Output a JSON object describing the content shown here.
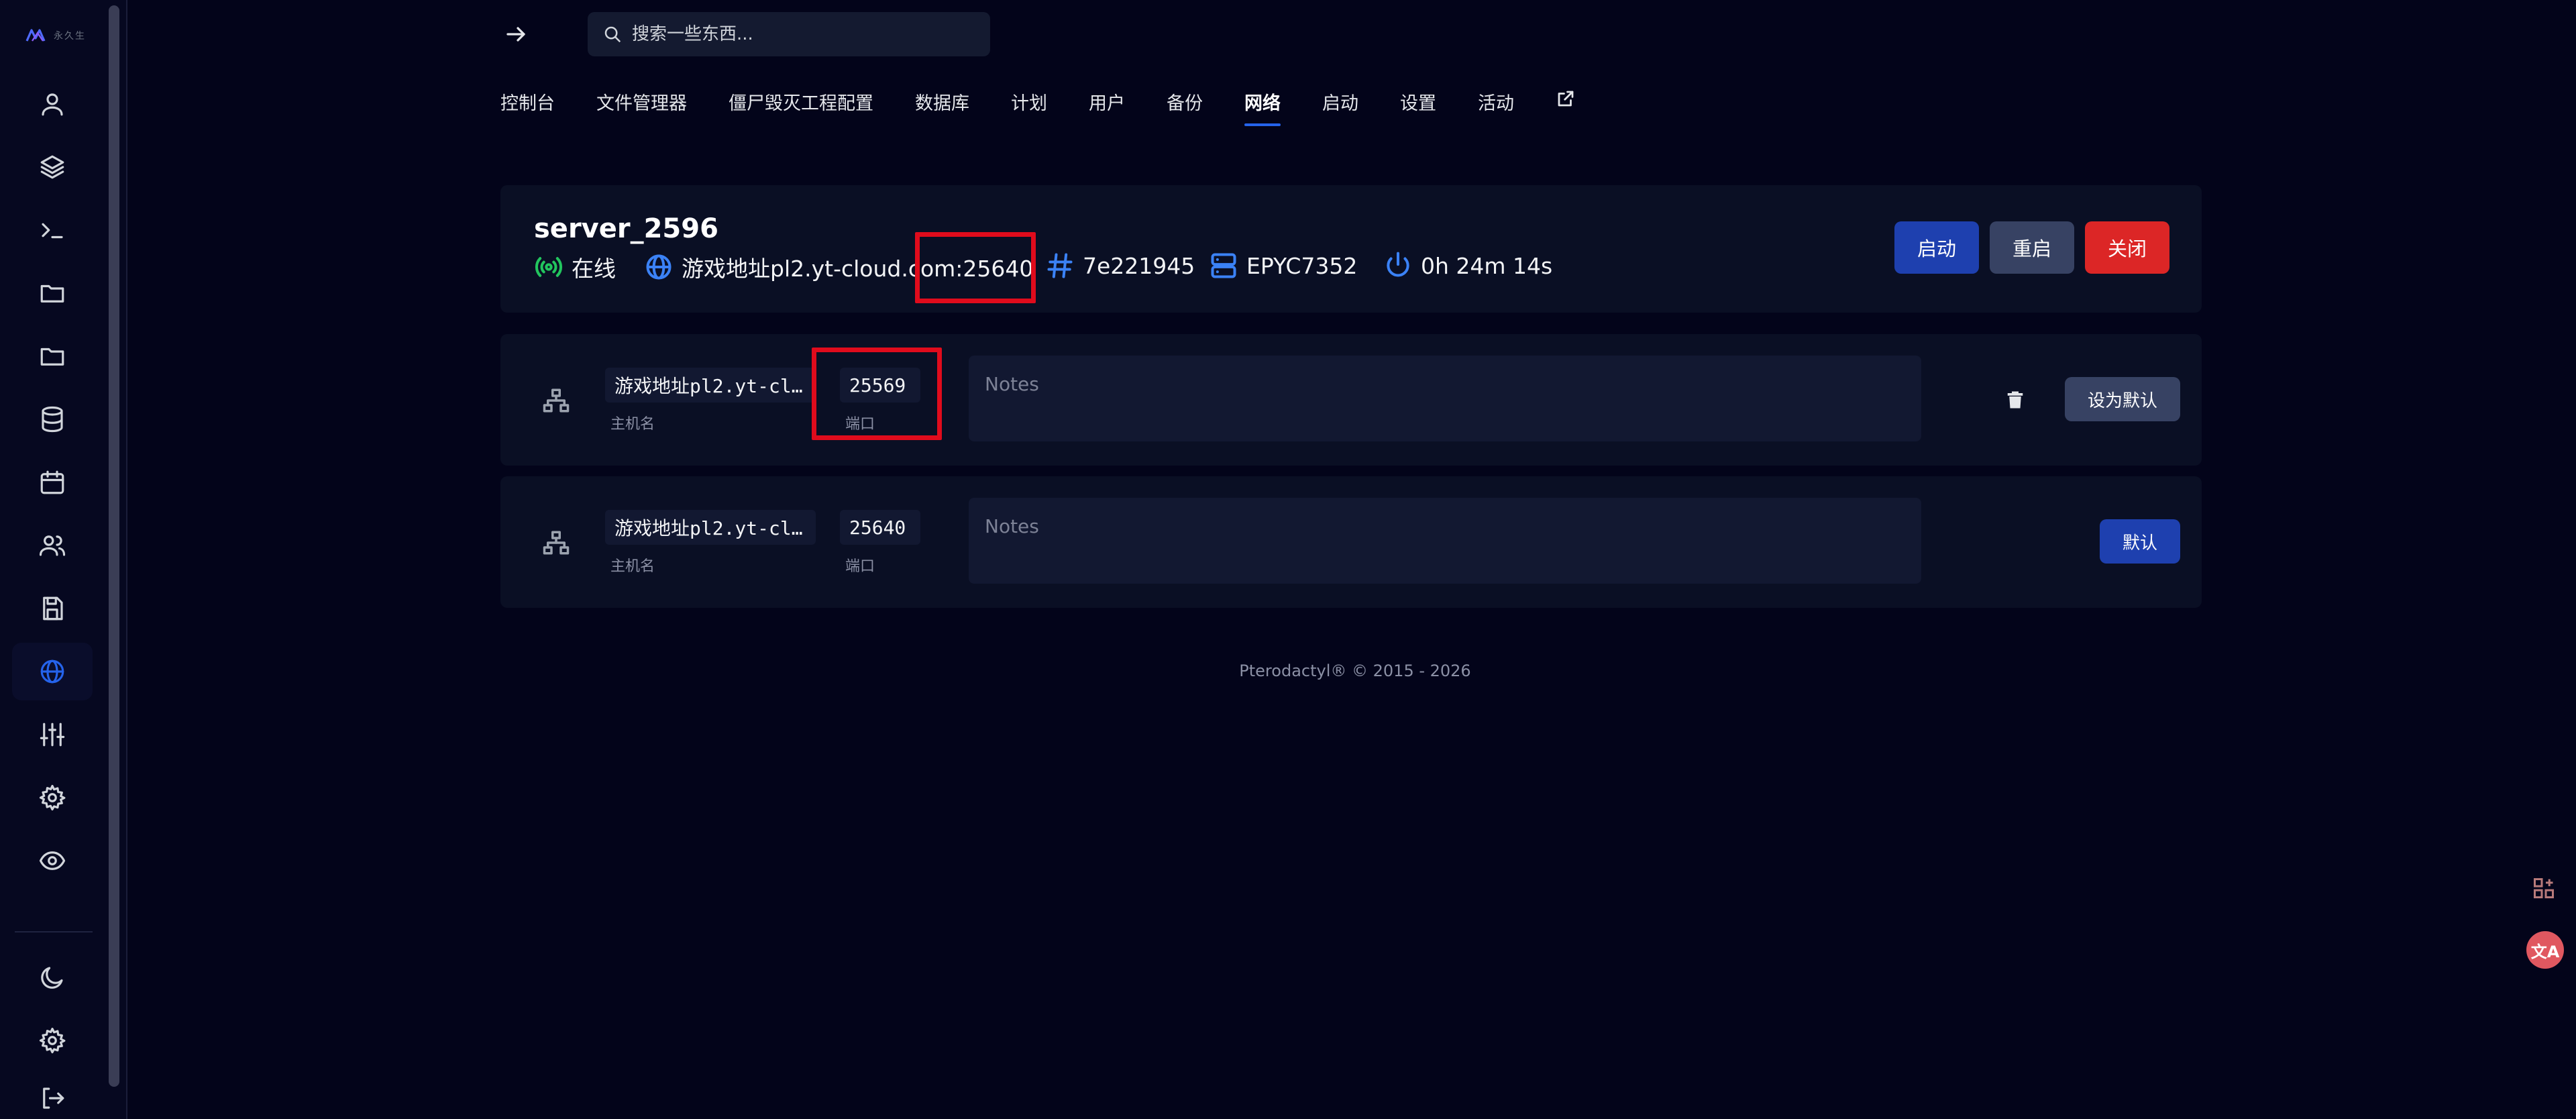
{
  "sidebar": {
    "logo_text": "永久生",
    "items": [
      {
        "name": "account",
        "icon": "user-icon"
      },
      {
        "name": "servers",
        "icon": "layers-icon"
      },
      {
        "name": "console",
        "icon": "terminal-icon"
      },
      {
        "name": "files",
        "icon": "folder-icon"
      },
      {
        "name": "folder",
        "icon": "folder-icon"
      },
      {
        "name": "database",
        "icon": "database-icon"
      },
      {
        "name": "schedules",
        "icon": "calendar-icon"
      },
      {
        "name": "users",
        "icon": "users-icon"
      },
      {
        "name": "backups",
        "icon": "save-icon"
      },
      {
        "name": "network",
        "icon": "globe-icon",
        "active": true
      },
      {
        "name": "startup",
        "icon": "sliders-icon"
      },
      {
        "name": "settings",
        "icon": "gear-icon"
      },
      {
        "name": "activity",
        "icon": "eye-icon"
      }
    ],
    "bottom": [
      {
        "name": "theme",
        "icon": "moon-icon"
      },
      {
        "name": "admin",
        "icon": "gear-icon"
      },
      {
        "name": "logout",
        "icon": "logout-icon"
      }
    ]
  },
  "search": {
    "placeholder": "搜索一些东西..."
  },
  "tabs": [
    {
      "label": "控制台"
    },
    {
      "label": "文件管理器"
    },
    {
      "label": "僵尸毁灭工程配置"
    },
    {
      "label": "数据库"
    },
    {
      "label": "计划"
    },
    {
      "label": "用户"
    },
    {
      "label": "备份"
    },
    {
      "label": "网络",
      "active": true
    },
    {
      "label": "启动"
    },
    {
      "label": "设置"
    },
    {
      "label": "活动"
    }
  ],
  "server": {
    "name": "server_2596",
    "status": "在线",
    "address": "游戏地址pl2.yt-cloud.com:25640",
    "id": "7e221945",
    "cpu": "EPYC7352",
    "uptime": "0h 24m 14s",
    "buttons": {
      "start": "启动",
      "restart": "重启",
      "stop": "关闭"
    }
  },
  "allocations": [
    {
      "host": "游戏地址pl2.yt-cl…",
      "host_label": "主机名",
      "port": "25569",
      "port_label": "端口",
      "notes_placeholder": "Notes",
      "action": "设为默认",
      "deletable": true
    },
    {
      "host": "游戏地址pl2.yt-cl…",
      "host_label": "主机名",
      "port": "25640",
      "port_label": "端口",
      "notes_placeholder": "Notes",
      "action": "默认",
      "deletable": false
    }
  ],
  "footer": "Pterodactyl® © 2015 - 2026",
  "colors": {
    "background": "#03041a",
    "card": "#0a0f24",
    "accent": "#2563eb",
    "danger": "#dc2626",
    "online": "#22c55e",
    "highlight": "#e00b1c"
  }
}
